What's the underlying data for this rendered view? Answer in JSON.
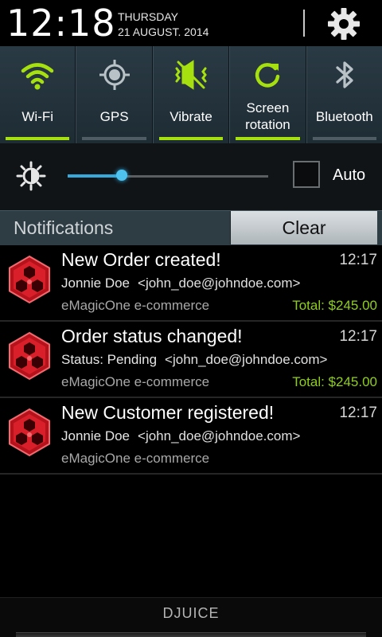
{
  "status": {
    "time": "12:18",
    "weekday": "THURSDAY",
    "date": "21 AUGUST. 2014"
  },
  "quick_settings": [
    {
      "label": "Wi-Fi",
      "icon": "wifi-icon",
      "on": true
    },
    {
      "label": "GPS",
      "icon": "gps-icon",
      "on": false
    },
    {
      "label": "Vibrate",
      "icon": "vibrate-icon",
      "on": true
    },
    {
      "label_line1": "Screen",
      "label_line2": "rotation",
      "icon": "rotation-icon",
      "on": true
    },
    {
      "label": "Bluetooth",
      "icon": "bluetooth-icon",
      "on": false
    }
  ],
  "brightness": {
    "level": 0.27,
    "auto_label": "Auto",
    "auto_checked": false
  },
  "notifications_header": {
    "title": "Notifications",
    "clear_label": "Clear"
  },
  "notifications": [
    {
      "title": "New Order created!",
      "time": "12:17",
      "line1": "Jonnie Doe",
      "email": "<john_doe@johndoe.com>",
      "app": "eMagicOne e-commerce",
      "total": "Total: $245.00"
    },
    {
      "title": "Order status changed!",
      "time": "12:17",
      "line1": "Status: Pending",
      "email": "<john_doe@johndoe.com>",
      "app": "eMagicOne e-commerce",
      "total": "Total: $245.00"
    },
    {
      "title": "New Customer registered!",
      "time": "12:17",
      "line1": "Jonnie Doe",
      "email": "<john_doe@johndoe.com>",
      "app": "eMagicOne e-commerce",
      "total": ""
    }
  ],
  "carrier": "DJUICE",
  "colors": {
    "accent_on": "#a6e00f",
    "slider": "#35a9db",
    "total_green": "#8fcf1b",
    "app_icon_red": "#d9202a"
  }
}
